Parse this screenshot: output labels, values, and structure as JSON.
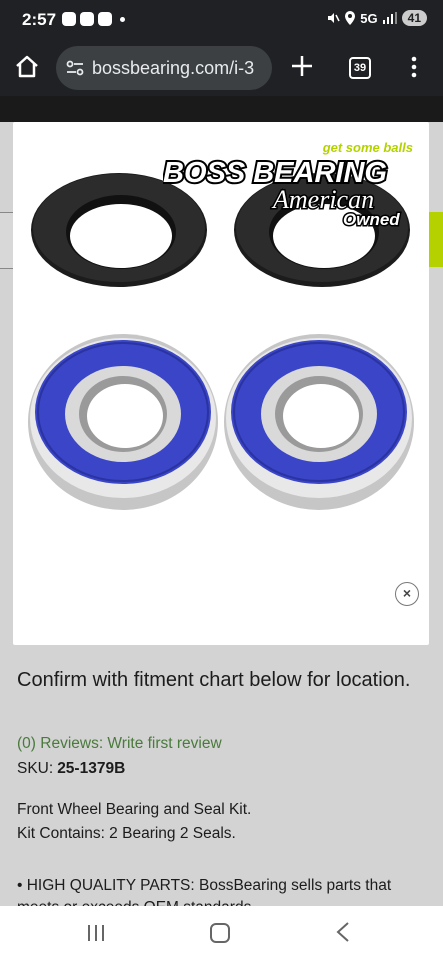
{
  "status_bar": {
    "time": "2:57",
    "network": "5G",
    "battery": "41"
  },
  "browser": {
    "url": "bossbearing.com/i-3",
    "tab_count": "39"
  },
  "modal": {
    "logo_tagline": "get some balls",
    "logo_name": "BOSS BEARING",
    "logo_sub1": "American",
    "logo_sub2": "Owned",
    "close_label": "×"
  },
  "product": {
    "fitment_note": "Confirm with fitment chart below for location.",
    "reviews_link": "(0) Reviews: Write first review",
    "sku_label": "SKU:",
    "sku_value": "25-1379B",
    "description_line1": "Front Wheel Bearing and Seal Kit.",
    "description_line2": "Kit Contains: 2 Bearing 2 Seals.",
    "bullet_text": "• HIGH QUALITY PARTS: BossBearing sells parts that meets or exceeds OEM standards"
  },
  "colors": {
    "accent_green": "#b5d200",
    "bearing_blue": "#3a45c8",
    "link_green": "#4a7a3c"
  }
}
